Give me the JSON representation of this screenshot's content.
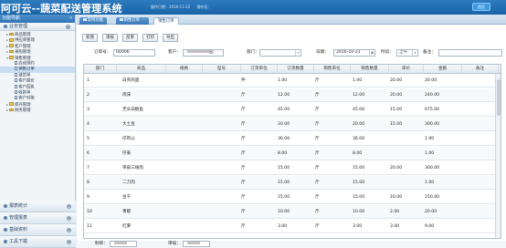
{
  "app": {
    "title": "阿可云--蔬菜配送管理系统",
    "meta": [
      "操作日期：2016-11-22",
      "操作员：",
      "IP：",
      "角色："
    ],
    "home_button": "首页"
  },
  "sidebar": {
    "header": "功能导航",
    "collapse_glyph": "«",
    "sections_top": [
      {
        "label": "业务管理",
        "glyph": "⌃"
      }
    ],
    "tree": [
      {
        "label": "商品管理",
        "level": 1,
        "kind": "folder",
        "toggle": "▸"
      },
      {
        "label": "供应商管理",
        "level": 1,
        "kind": "folder",
        "toggle": "▸"
      },
      {
        "label": "客户管理",
        "level": 1,
        "kind": "folder",
        "toggle": "▸"
      },
      {
        "label": "采购管理",
        "level": 1,
        "kind": "folder",
        "toggle": "▸"
      },
      {
        "label": "销售管理",
        "level": 1,
        "kind": "folder",
        "toggle": "▾"
      },
      {
        "label": "启动预约",
        "level": 2,
        "kind": "doc",
        "toggle": ""
      },
      {
        "label": "销售订单",
        "level": 2,
        "kind": "doc",
        "toggle": "",
        "selected": true
      },
      {
        "label": "送货单",
        "level": 2,
        "kind": "doc",
        "toggle": ""
      },
      {
        "label": "客户报价",
        "level": 2,
        "kind": "doc",
        "toggle": ""
      },
      {
        "label": "客户回执",
        "level": 2,
        "kind": "doc",
        "toggle": ""
      },
      {
        "label": "收款单",
        "level": 2,
        "kind": "doc",
        "toggle": ""
      },
      {
        "label": "客户对账",
        "level": 2,
        "kind": "doc",
        "toggle": ""
      },
      {
        "label": "库存管理",
        "level": 1,
        "kind": "folder",
        "toggle": "▸"
      },
      {
        "label": "财务管理",
        "level": 1,
        "kind": "folder",
        "toggle": "▸"
      }
    ],
    "sections_bottom": [
      {
        "label": "报表统计",
        "glyph": "⌄"
      },
      {
        "label": "管理报表",
        "glyph": "⌄"
      },
      {
        "label": "基础资料",
        "glyph": "⌄"
      },
      {
        "label": "工具下载",
        "glyph": "⌄"
      }
    ]
  },
  "tabs": [
    {
      "label": "常用功能",
      "closable": false,
      "active": false
    },
    {
      "label": "销售订单",
      "closable": true,
      "active": false
    },
    {
      "label": "销售订单",
      "closable": false,
      "active": true
    }
  ],
  "toolbar": [
    "新增",
    "审核",
    "反审",
    "打印",
    "导出"
  ],
  "form": {
    "order_no_label": "订单号：",
    "order_no_value": "00006",
    "customer_label": "客户：",
    "customer_suffix": "园",
    "dept_label": "部门：",
    "date_label": "日期：",
    "date_value": "2016-10-21",
    "period_label": "时段：",
    "period_value": "上午",
    "remark_label": "备注："
  },
  "grid": {
    "columns": [
      "部门",
      "商品",
      "规格",
      "型号",
      "订货单位",
      "订货数量",
      "销售单位",
      "销售数量",
      "单价",
      "金额",
      "备注"
    ],
    "rows": [
      {
        "no": "1",
        "item": "白壳鸡蛋",
        "unit": "件",
        "qty": "1.00",
        "sunit": "斤",
        "sqty": "1.00",
        "price": "20.00",
        "amount": "20.00"
      },
      {
        "no": "2",
        "item": "肉沫",
        "unit": "斤",
        "qty": "12.00",
        "sunit": "斤",
        "sqty": "12.00",
        "price": "20.00",
        "amount": "240.00"
      },
      {
        "no": "3",
        "item": "无头白鲢鱼",
        "unit": "斤",
        "qty": "45.00",
        "sunit": "斤",
        "sqty": "45.00",
        "price": "15.00",
        "amount": "675.00"
      },
      {
        "no": "4",
        "item": "大土豆",
        "unit": "斤",
        "qty": "20.00",
        "sunit": "斤",
        "sqty": "20.00",
        "price": "15.00",
        "amount": "300.00"
      },
      {
        "no": "5",
        "item": "仔鸡公",
        "unit": "斤",
        "qty": "36.00",
        "sunit": "斤",
        "sqty": "36.00",
        "price": "",
        "amount": "1.00"
      },
      {
        "no": "6",
        "item": "仔姜",
        "unit": "斤",
        "qty": "8.00",
        "sunit": "斤",
        "sqty": "8.00",
        "price": "",
        "amount": "1.00"
      },
      {
        "no": "7",
        "item": "带皮三线肉",
        "unit": "斤",
        "qty": "15.00",
        "sunit": "斤",
        "sqty": "15.00",
        "price": "20.00",
        "amount": "300.00"
      },
      {
        "no": "8",
        "item": "二刀肉",
        "unit": "斤",
        "qty": "15.00",
        "sunit": "斤",
        "sqty": "15.00",
        "price": "",
        "amount": "1.00"
      },
      {
        "no": "9",
        "item": "豆干",
        "unit": "斤",
        "qty": "15.00",
        "sunit": "斤",
        "sqty": "15.00",
        "price": "10.00",
        "amount": "150.00"
      },
      {
        "no": "10",
        "item": "青椒",
        "unit": "斤",
        "qty": "10.00",
        "sunit": "斤",
        "sqty": "10.00",
        "price": "2.00",
        "amount": "20.00"
      },
      {
        "no": "11",
        "item": "红萝",
        "unit": "斤",
        "qty": "3.00",
        "sunit": "斤",
        "sqty": "3.00",
        "price": "3.00",
        "amount": "9.00"
      }
    ]
  },
  "footer": {
    "maker_label": "制单：",
    "auditor_label": "审核："
  }
}
